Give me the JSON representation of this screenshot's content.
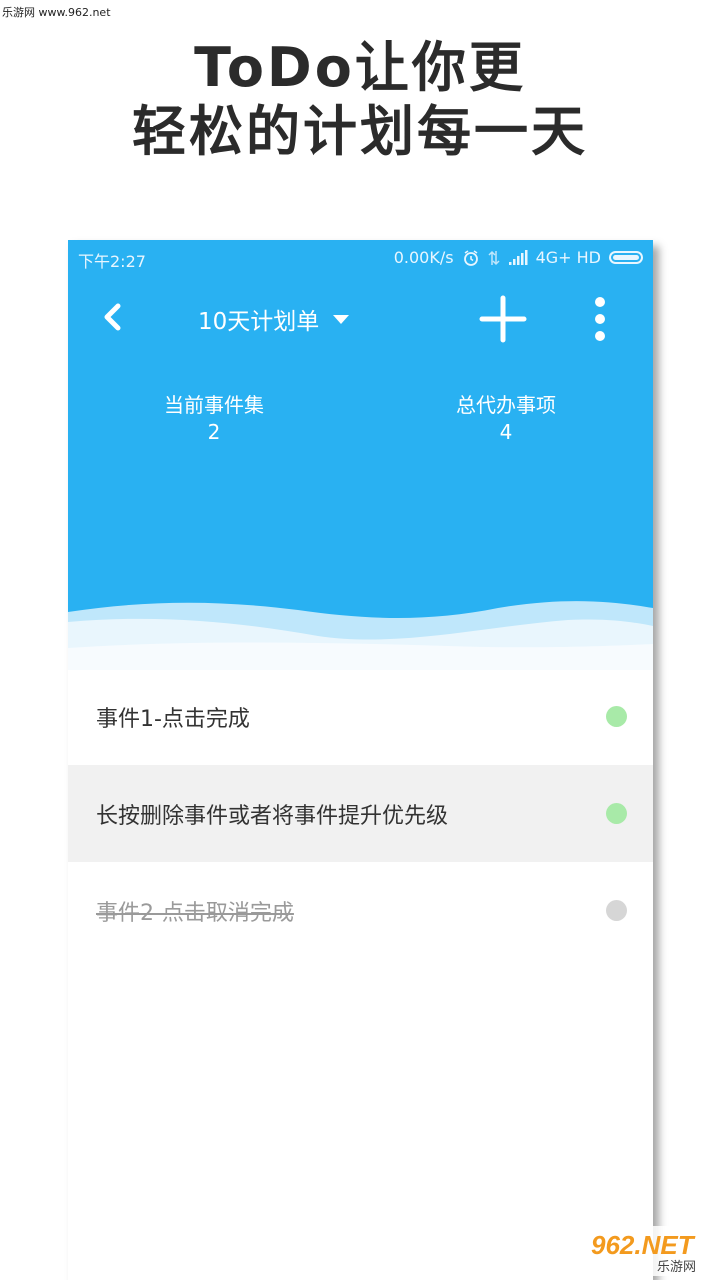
{
  "watermark": {
    "top_text": "乐游网 www.962.net",
    "bottom_logo_text": "962.NET",
    "bottom_logo_subtext": "乐游网"
  },
  "headline": {
    "line1": "ToDo让你更",
    "line2": "轻松的计划每一天"
  },
  "status_bar": {
    "time": "下午2:27",
    "speed": "0.00K/s",
    "network": "4G+ HD"
  },
  "toolbar": {
    "title": "10天计划单"
  },
  "stats": [
    {
      "label": "当前事件集",
      "value": "2"
    },
    {
      "label": "总代办事项",
      "value": "4"
    }
  ],
  "tasks": [
    {
      "label": "事件1-点击完成",
      "state": "active",
      "dot_color": "#a8eaa8"
    },
    {
      "label": "长按删除事件或者将事件提升优先级",
      "state": "active",
      "dot_color": "#a8eaa8"
    },
    {
      "label": "事件2-点击取消完成",
      "state": "done",
      "dot_color": "#d6d6d6"
    }
  ],
  "colors": {
    "primary": "#29b1f2",
    "selected_row": "#f1f1f1"
  }
}
